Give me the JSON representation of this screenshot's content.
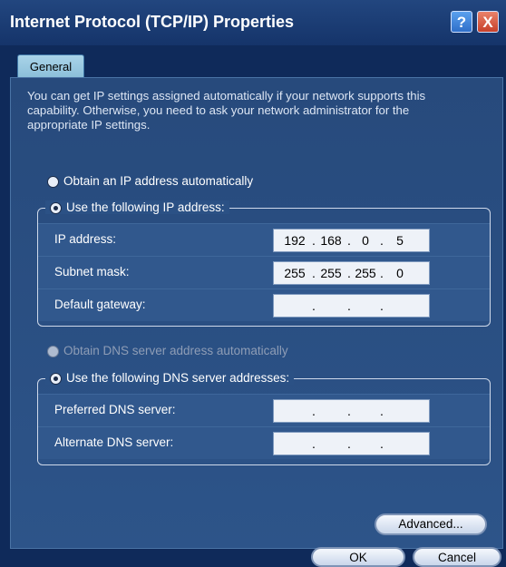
{
  "window": {
    "title": "Internet Protocol (TCP/IP) Properties",
    "help_label": "?",
    "close_label": "X"
  },
  "tabs": [
    {
      "label": "General",
      "selected": true
    }
  ],
  "intro_text": "You can get IP settings assigned automatically if your network supports this capability. Otherwise, you need to ask your network administrator for the appropriate IP settings.",
  "ip_section": {
    "auto_label": "Obtain an IP address automatically",
    "manual_label": "Use the following IP address:",
    "selected": "manual",
    "fields": [
      {
        "label": "IP address:",
        "octets": [
          "192",
          "168",
          "0",
          "5"
        ]
      },
      {
        "label": "Subnet mask:",
        "octets": [
          "255",
          "255",
          "255",
          "0"
        ]
      },
      {
        "label": "Default gateway:",
        "octets": [
          "",
          "",
          "",
          ""
        ]
      }
    ]
  },
  "dns_section": {
    "auto_label": "Obtain DNS server address automatically",
    "manual_label": "Use the following DNS server addresses:",
    "selected": "manual",
    "auto_disabled": true,
    "fields": [
      {
        "label": "Preferred DNS server:",
        "octets": [
          "",
          "",
          "",
          ""
        ]
      },
      {
        "label": "Alternate DNS server:",
        "octets": [
          "",
          "",
          "",
          ""
        ]
      }
    ]
  },
  "buttons": {
    "advanced": "Advanced...",
    "ok": "OK",
    "cancel": "Cancel"
  }
}
